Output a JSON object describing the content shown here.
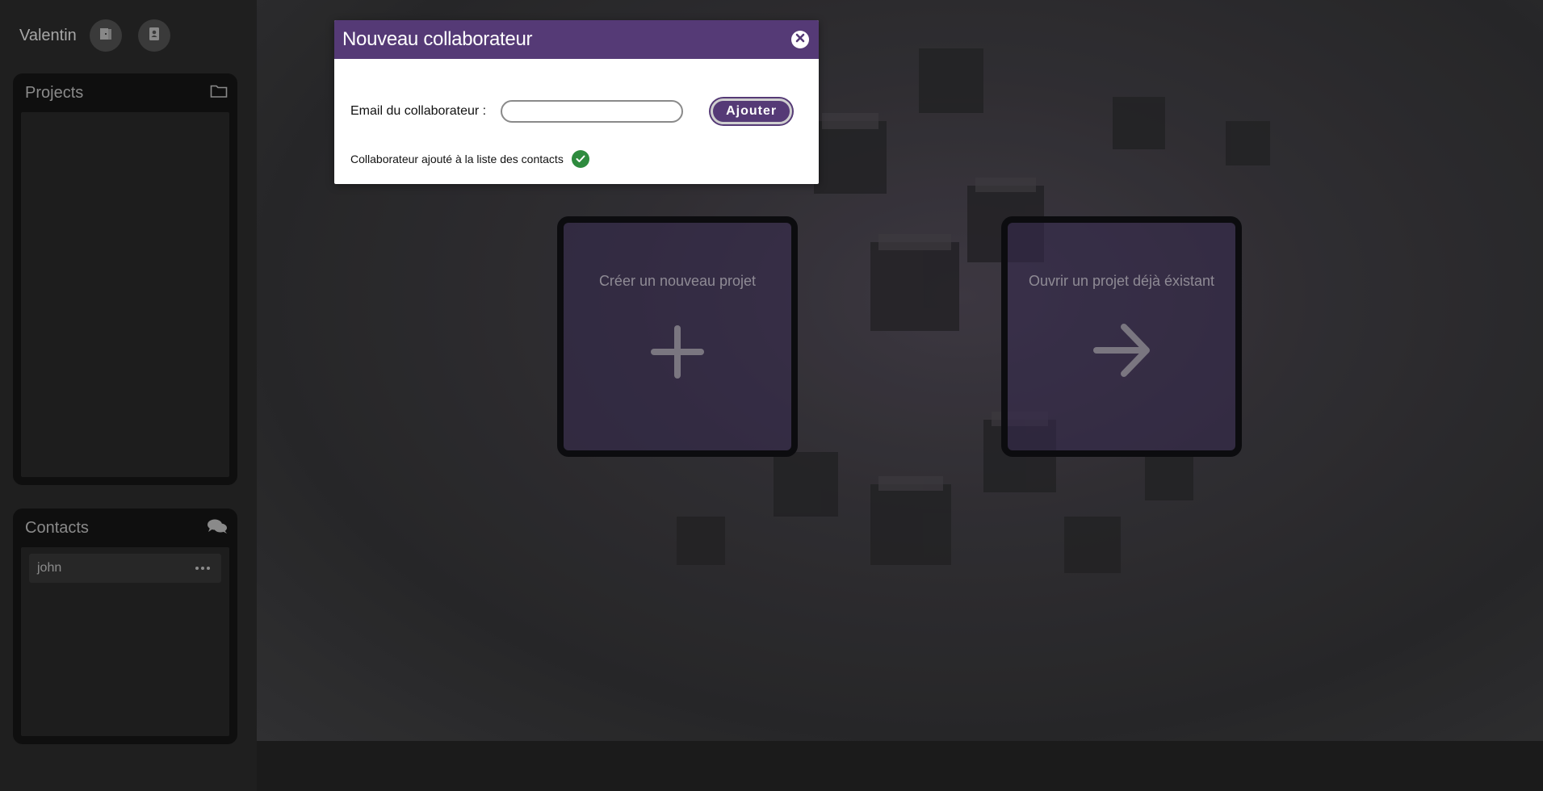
{
  "sidebar": {
    "user_name": "Valentin",
    "icons": [
      "door-icon",
      "contacts-book-icon"
    ],
    "projects": {
      "title": "Projects",
      "icon": "folder-icon",
      "items": []
    },
    "contacts": {
      "title": "Contacts",
      "icon": "chat-bubbles-icon",
      "items": [
        {
          "name": "john",
          "menu_icon": "more-dots-icon"
        }
      ]
    }
  },
  "main": {
    "create_card": {
      "label": "Créer un nouveau projet",
      "icon": "plus-icon"
    },
    "open_card": {
      "label": "Ouvrir un projet déjà éxistant",
      "icon": "arrow-right-icon"
    }
  },
  "modal": {
    "title": "Nouveau collaborateur",
    "email_label": "Email du collaborateur :",
    "email_value": "",
    "email_placeholder": "",
    "add_button": "Ajouter",
    "status_message": "Collaborateur ajouté à la liste des contacts",
    "status_icon": "check-circle-icon"
  },
  "colors": {
    "accent": "#553a76",
    "success": "#2e8b3e",
    "sidebar_bg": "#1f1f1f",
    "panel_bg": "#0f0f0f"
  }
}
